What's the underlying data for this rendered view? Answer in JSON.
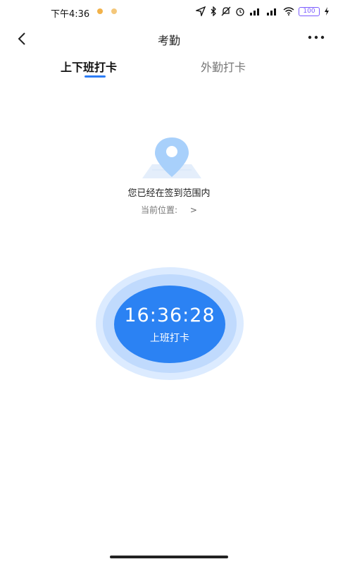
{
  "status_bar": {
    "time": "下午4:36",
    "battery": "100"
  },
  "header": {
    "title": "考勤",
    "back_icon": "chevron-left-icon",
    "more_icon": "more-dots-icon",
    "more_text": "···"
  },
  "tabs": [
    {
      "label": "上下班打卡",
      "active": true
    },
    {
      "label": "外勤打卡",
      "active": false
    }
  ],
  "location": {
    "status_text": "您已经在签到范围内",
    "current_label": "当前位置:",
    "chevron": ">"
  },
  "punch": {
    "time": "16:36:28",
    "label": "上班打卡"
  },
  "colors": {
    "accent": "#2b82f3",
    "ring_outer": "#dcebff",
    "ring_mid": "#c0dafd"
  }
}
